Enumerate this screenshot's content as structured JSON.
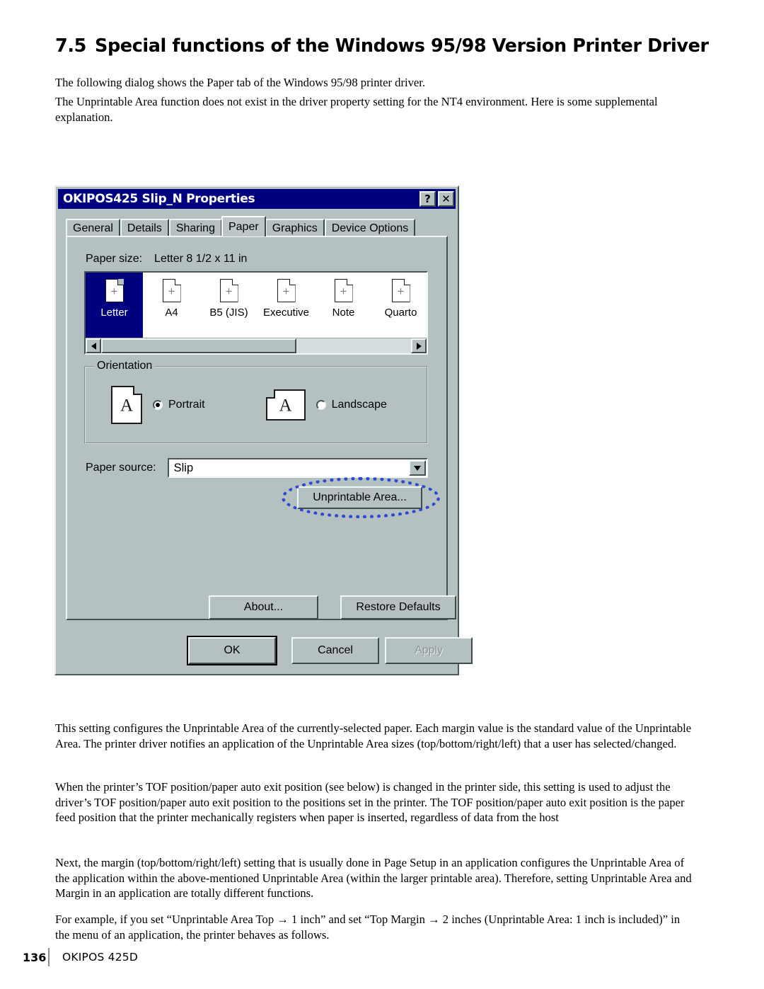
{
  "document": {
    "heading_number": "7.5",
    "heading_text": "Special functions of the Windows 95/98 Version Printer Driver",
    "intro_line_1": "The following dialog shows the Paper tab of the Windows 95/98 printer driver.",
    "intro_line_2": "The Unprintable Area function does not exist in the driver property setting for the NT4 environment. Here is some supplemental explanation.",
    "body_1": "This setting configures the Unprintable Area of the currently-selected paper. Each margin value is the standard value of the Unprintable Area. The printer driver notifies an application of the Unprintable Area sizes (top/bottom/right/left) that a user has selected/changed.",
    "body_2": "When the printer’s TOF position/paper auto exit position (see below) is changed in the printer side, this setting is used to adjust the driver’s TOF position/paper auto exit position to the positions set in the printer. The TOF position/paper auto exit position is the paper feed position that the printer mechanically registers when paper is inserted, regardless of data from the host",
    "body_3": "Next, the margin (top/bottom/right/left) setting that is usually done in Page Setup in an application configures the Unprintable Area of the application within the above-mentioned Unprintable Area (within the larger printable area). Therefore, setting Unprintable Area and Margin in an application are totally different functions.",
    "body_4": "For example, if you set “Unprintable Area Top → 1 inch” and set “Top Margin → 2 inches (Unprintable Area: 1 inch is included)” in the menu of an application, the printer behaves as follows.",
    "footer_page_number": "136",
    "footer_model": "OKIPOS 425D"
  },
  "dialog": {
    "title": "OKIPOS425 Slip_N Properties",
    "help_button": "?",
    "close_button": "✕",
    "tabs": [
      {
        "label": "General",
        "active": false
      },
      {
        "label": "Details",
        "active": false
      },
      {
        "label": "Sharing",
        "active": false
      },
      {
        "label": "Paper",
        "active": true
      },
      {
        "label": "Graphics",
        "active": false
      },
      {
        "label": "Device Options",
        "active": false
      }
    ],
    "paper_size": {
      "label": "Paper size:",
      "value": "Letter 8 1/2 x 11 in",
      "items": [
        {
          "caption": "Letter",
          "selected": true
        },
        {
          "caption": "A4",
          "selected": false
        },
        {
          "caption": "B5 (JIS)",
          "selected": false
        },
        {
          "caption": "Executive",
          "selected": false
        },
        {
          "caption": "Note",
          "selected": false
        },
        {
          "caption": "Quarto",
          "selected": false
        }
      ],
      "scroll_left_arrow": "◀",
      "scroll_right_arrow": "▶"
    },
    "orientation": {
      "group_title": "Orientation",
      "portrait_label": "Portrait",
      "portrait_selected": true,
      "landscape_label": "Landscape",
      "landscape_selected": false,
      "icon_letter": "A"
    },
    "paper_source": {
      "label": "Paper source:",
      "value": "Slip"
    },
    "buttons": {
      "unprintable_area": "Unprintable Area...",
      "about": "About...",
      "restore_defaults": "Restore Defaults",
      "ok": "OK",
      "cancel": "Cancel",
      "apply": "Apply"
    }
  },
  "colors": {
    "titlebar": "#00007e",
    "dialog_face": "#b5c0c0",
    "selection": "#00007e",
    "annotation_ellipse": "#2a49d4"
  }
}
